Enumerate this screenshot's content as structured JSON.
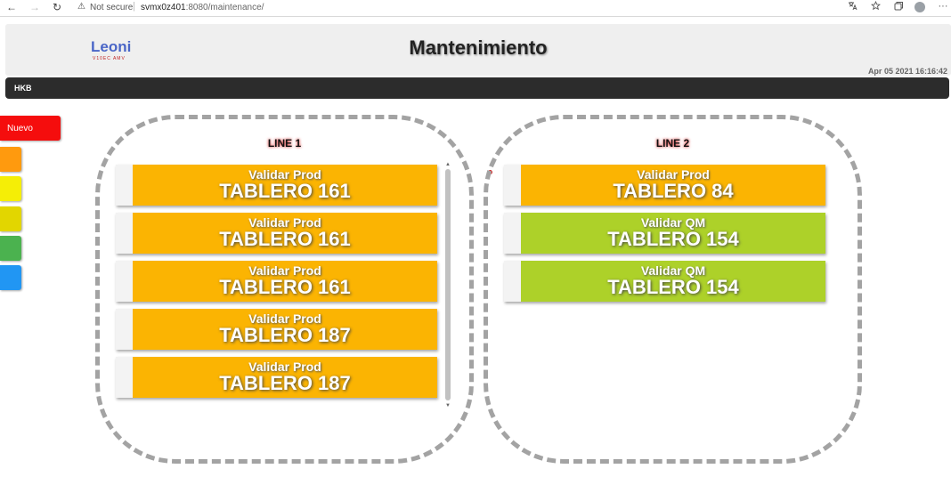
{
  "browser": {
    "back_icon": "←",
    "forward_icon": "→",
    "reload_icon": "↻",
    "warning_icon": "⚠",
    "not_secure": "Not secure",
    "separator": "|",
    "url_host": "svmx0z401",
    "url_rest": ":8080/maintenance/",
    "icon_names": [
      "translate-icon",
      "favorite-icon",
      "collections-icon",
      "profile-icon",
      "more-icon"
    ],
    "more_icon": "···"
  },
  "header": {
    "logo": "Leoni",
    "logo_sub": "V10EC AMV",
    "title": "Mantenimiento",
    "datetime": "Apr 05 2021 16:16:42"
  },
  "navbar": {
    "label": "HKB"
  },
  "side_tabs": {
    "nuevo": "Nuevo",
    "colors": [
      "#f50d0d",
      "#ff9a0e",
      "#f5ee06",
      "#e2d600",
      "#4bb24f",
      "#2196f3"
    ]
  },
  "lines": [
    {
      "title": "LINE 1",
      "cards": [
        {
          "action": "Validar Prod",
          "tablero": "TABLERO 161",
          "color": "#fbb402"
        },
        {
          "action": "Validar Prod",
          "tablero": "TABLERO 161",
          "color": "#fbb402"
        },
        {
          "action": "Validar Prod",
          "tablero": "TABLERO 161",
          "color": "#fbb402"
        },
        {
          "action": "Validar Prod",
          "tablero": "TABLERO 187",
          "color": "#fbb402"
        },
        {
          "action": "Validar Prod",
          "tablero": "TABLERO 187",
          "color": "#fbb402"
        }
      ]
    },
    {
      "title": "LINE 2",
      "cards": [
        {
          "action": "Validar Prod",
          "tablero": "TABLERO 84",
          "color": "#fbb402"
        },
        {
          "action": "Validar QM",
          "tablero": "TABLERO 154",
          "color": "#add129"
        },
        {
          "action": "Validar QM",
          "tablero": "TABLERO 154",
          "color": "#add129"
        }
      ]
    }
  ]
}
